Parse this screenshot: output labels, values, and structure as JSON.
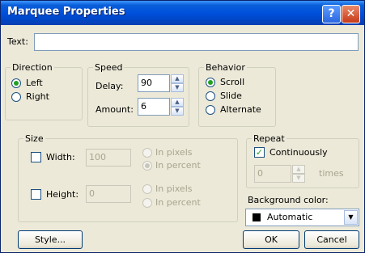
{
  "window": {
    "title": "Marquee Properties",
    "help_glyph": "?",
    "close_glyph": "✕"
  },
  "text_field": {
    "label": "Text:",
    "value": ""
  },
  "direction": {
    "legend": "Direction",
    "options": [
      {
        "label": "Left",
        "selected": true
      },
      {
        "label": "Right",
        "selected": false
      }
    ]
  },
  "speed": {
    "legend": "Speed",
    "delay_label": "Delay:",
    "delay_value": "90",
    "amount_label": "Amount:",
    "amount_value": "6"
  },
  "behavior": {
    "legend": "Behavior",
    "options": [
      {
        "label": "Scroll",
        "selected": true
      },
      {
        "label": "Slide",
        "selected": false
      },
      {
        "label": "Alternate",
        "selected": false
      }
    ]
  },
  "size": {
    "legend": "Size",
    "width_label": "Width:",
    "width_value": "100",
    "width_checked": false,
    "width_units": [
      "In pixels",
      "In percent"
    ],
    "height_label": "Height:",
    "height_value": "0",
    "height_checked": false,
    "height_units": [
      "In pixels",
      "In percent"
    ]
  },
  "repeat": {
    "legend": "Repeat",
    "continuously_label": "Continuously",
    "continuously_checked": true,
    "times_value": "0",
    "times_label": "times"
  },
  "background": {
    "label": "Background color:",
    "value": "Automatic",
    "swatch_color": "#000000"
  },
  "buttons": {
    "style": "Style...",
    "ok": "OK",
    "cancel": "Cancel"
  },
  "spin_glyphs": {
    "up": "▲",
    "down": "▼"
  },
  "dropdown_glyph": "▼",
  "check_glyph": "✓"
}
